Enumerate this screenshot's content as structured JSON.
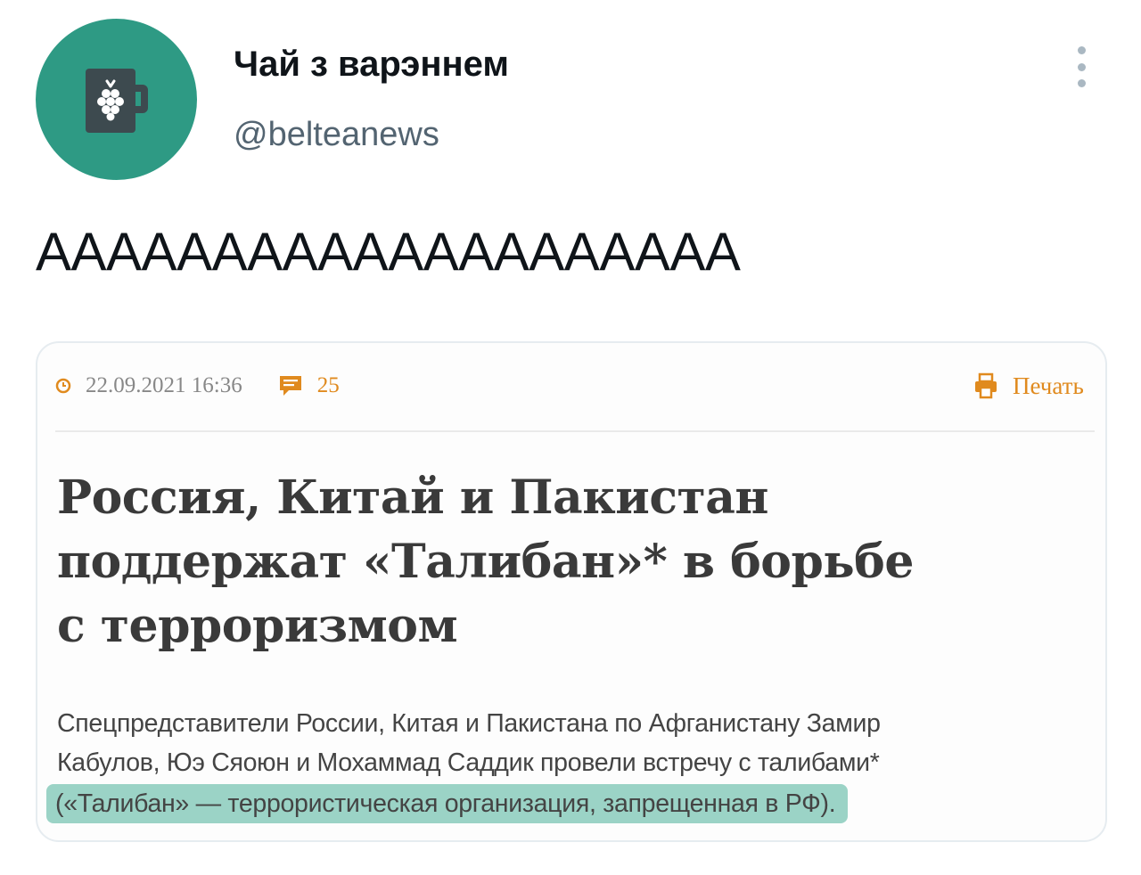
{
  "author": {
    "display_name": "Чай з варэннем",
    "handle": "@belteanews",
    "avatar_color": "#2e9a84"
  },
  "tweet": {
    "text": "АААААААААААААААААААА"
  },
  "article": {
    "date": "22.09.2021",
    "time": "16:36",
    "comments_count": "25",
    "print_label": "Печать",
    "accent_color": "#e08a1e",
    "headline_lines": [
      "Россия, Китай и Пакистан",
      "поддержат «Талибан»* в борьбе",
      "с терроризмом"
    ],
    "lead_lines": [
      "Спецпредставители России, Китая и Пакистана по Афганистану Замир",
      "Кабулов, Юэ Сяоюн и Мохаммад Саддик провели встречу с талибами*"
    ],
    "footnote": "(«Талибан» — террористическая организация, запрещенная в РФ).",
    "highlight_color": "#9bd3c6"
  },
  "icons": {
    "avatar": "mug-raspberry-icon",
    "more": "more-vertical-icon",
    "clock": "clock-icon",
    "comments": "comment-icon",
    "print": "printer-icon"
  }
}
